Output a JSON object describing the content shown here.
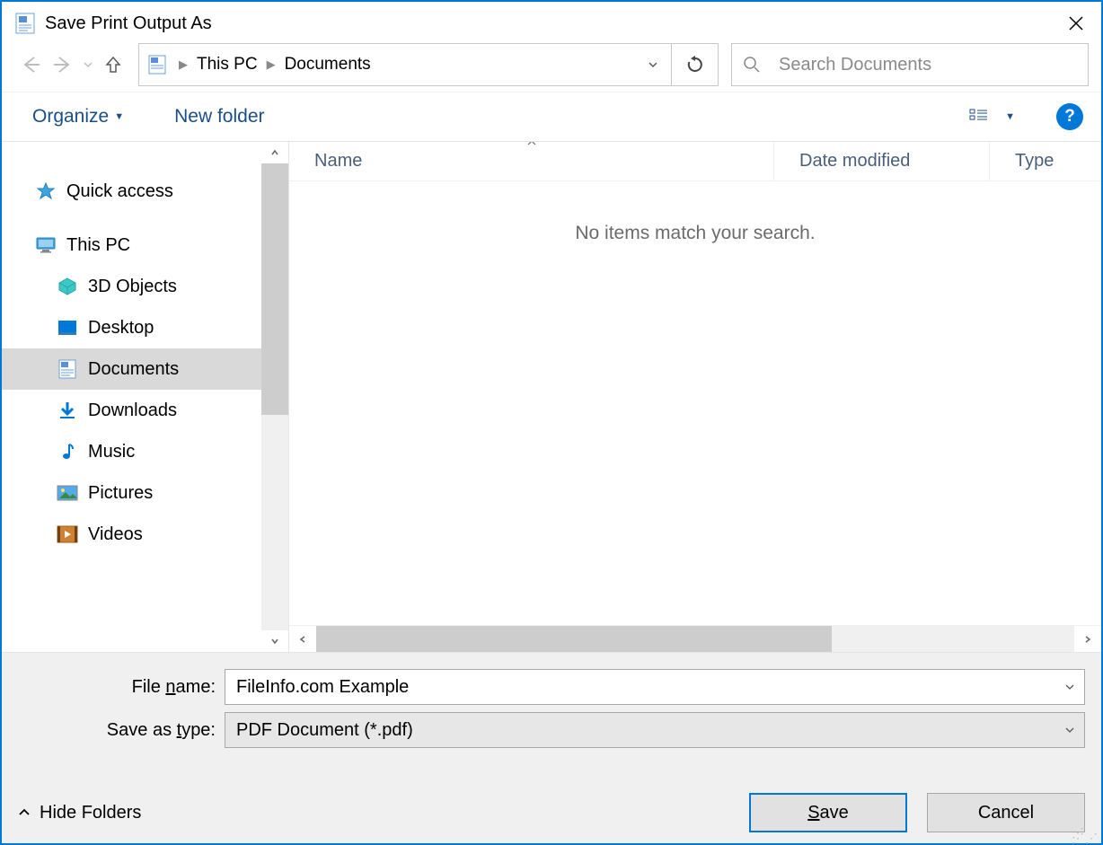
{
  "title": "Save Print Output As",
  "breadcrumb": {
    "parts": [
      "This PC",
      "Documents"
    ]
  },
  "search": {
    "placeholder": "Search Documents"
  },
  "toolbar": {
    "organize": "Organize",
    "new_folder": "New folder"
  },
  "tree": {
    "quick_access": "Quick access",
    "this_pc": "This PC",
    "items": [
      {
        "label": "3D Objects"
      },
      {
        "label": "Desktop"
      },
      {
        "label": "Documents"
      },
      {
        "label": "Downloads"
      },
      {
        "label": "Music"
      },
      {
        "label": "Pictures"
      },
      {
        "label": "Videos"
      }
    ]
  },
  "columns": {
    "name": "Name",
    "date": "Date modified",
    "type": "Type"
  },
  "empty_message": "No items match your search.",
  "form": {
    "filename_label_pre": "File ",
    "filename_label_ul": "n",
    "filename_label_post": "ame:",
    "filename_value": "FileInfo.com Example",
    "savetype_label_pre": "Save as ",
    "savetype_label_ul": "t",
    "savetype_label_post": "ype:",
    "savetype_value": "PDF Document (*.pdf)"
  },
  "footer": {
    "hide_folders": "Hide Folders",
    "save_ul": "S",
    "save_post": "ave",
    "cancel": "Cancel"
  }
}
